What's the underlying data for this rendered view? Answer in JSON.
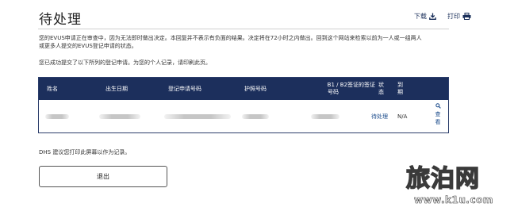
{
  "header": {
    "title": "待处理",
    "download_label": "下载",
    "print_label": "打印"
  },
  "notice": {
    "line1": "您的EVUS申请正在审查中，因为无法即时做出决定。本回复并不表示有负面的结果。决定将在72小时之内做出。回到这个网站来检索以前为一人或一组两人",
    "line2": "或更多人提交的EVUS登记申请的状态。"
  },
  "submitted_text": "您已成功提交了以下所列的登记申请。为您的个人记录，请印刷此页。",
  "table": {
    "columns": {
      "name": "姓名",
      "dob": "出生日期",
      "application_number": "登记申请号码",
      "passport_number": "护照号码",
      "visa_number_line1": "B1 / B2签证的签证",
      "visa_number_line2": "号码",
      "status_line1": "状",
      "status_line2": "态",
      "expiry_line1": "到",
      "expiry_line2": "期"
    },
    "row": {
      "status": "待处理",
      "expiry": "N/A",
      "view_line1": "查",
      "view_line2": "看"
    }
  },
  "dhs_note": "DHS 建议您打印此屏幕以作为记录。",
  "exit_label": "退出",
  "watermark": {
    "text": "旅泊网",
    "url": "www.k1u.com"
  },
  "colors": {
    "table_header_bg": "#1c2f5c",
    "link": "#1c4c8c"
  }
}
